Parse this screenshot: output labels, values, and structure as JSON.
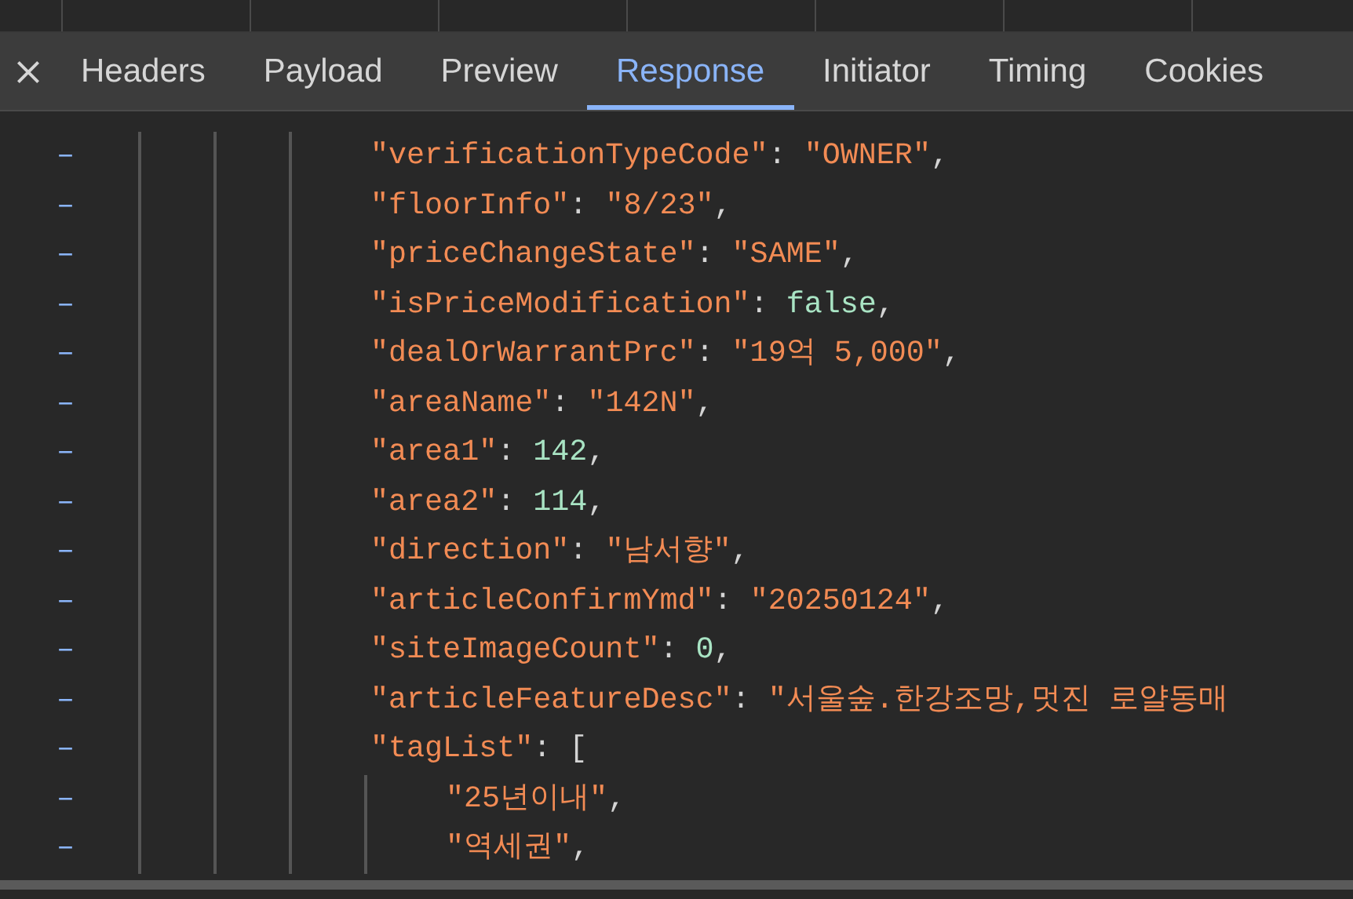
{
  "tabs": [
    {
      "label": "Headers",
      "selected": false
    },
    {
      "label": "Payload",
      "selected": false
    },
    {
      "label": "Preview",
      "selected": false
    },
    {
      "label": "Response",
      "selected": true
    },
    {
      "label": "Initiator",
      "selected": false
    },
    {
      "label": "Timing",
      "selected": false
    },
    {
      "label": "Cookies",
      "selected": false
    }
  ],
  "code_lines": [
    {
      "marker": "–",
      "parts": [
        {
          "kind": "key",
          "text": "\"verificationTypeCode\""
        },
        {
          "kind": "punct",
          "text": ": "
        },
        {
          "kind": "string",
          "text": "\"OWNER\""
        },
        {
          "kind": "punct",
          "text": ","
        }
      ]
    },
    {
      "marker": "–",
      "parts": [
        {
          "kind": "key",
          "text": "\"floorInfo\""
        },
        {
          "kind": "punct",
          "text": ": "
        },
        {
          "kind": "string",
          "text": "\"8/23\""
        },
        {
          "kind": "punct",
          "text": ","
        }
      ]
    },
    {
      "marker": "–",
      "parts": [
        {
          "kind": "key",
          "text": "\"priceChangeState\""
        },
        {
          "kind": "punct",
          "text": ": "
        },
        {
          "kind": "string",
          "text": "\"SAME\""
        },
        {
          "kind": "punct",
          "text": ","
        }
      ]
    },
    {
      "marker": "–",
      "parts": [
        {
          "kind": "key",
          "text": "\"isPriceModification\""
        },
        {
          "kind": "punct",
          "text": ": "
        },
        {
          "kind": "literal",
          "text": "false"
        },
        {
          "kind": "punct",
          "text": ","
        }
      ]
    },
    {
      "marker": "–",
      "parts": [
        {
          "kind": "key",
          "text": "\"dealOrWarrantPrc\""
        },
        {
          "kind": "punct",
          "text": ": "
        },
        {
          "kind": "string",
          "text": "\"19억 5,000\""
        },
        {
          "kind": "punct",
          "text": ","
        }
      ]
    },
    {
      "marker": "–",
      "parts": [
        {
          "kind": "key",
          "text": "\"areaName\""
        },
        {
          "kind": "punct",
          "text": ": "
        },
        {
          "kind": "string",
          "text": "\"142N\""
        },
        {
          "kind": "punct",
          "text": ","
        }
      ]
    },
    {
      "marker": "–",
      "parts": [
        {
          "kind": "key",
          "text": "\"area1\""
        },
        {
          "kind": "punct",
          "text": ": "
        },
        {
          "kind": "literal",
          "text": "142"
        },
        {
          "kind": "punct",
          "text": ","
        }
      ]
    },
    {
      "marker": "–",
      "parts": [
        {
          "kind": "key",
          "text": "\"area2\""
        },
        {
          "kind": "punct",
          "text": ": "
        },
        {
          "kind": "literal",
          "text": "114"
        },
        {
          "kind": "punct",
          "text": ","
        }
      ]
    },
    {
      "marker": "–",
      "parts": [
        {
          "kind": "key",
          "text": "\"direction\""
        },
        {
          "kind": "punct",
          "text": ": "
        },
        {
          "kind": "string",
          "text": "\"남서향\""
        },
        {
          "kind": "punct",
          "text": ","
        }
      ]
    },
    {
      "marker": "–",
      "parts": [
        {
          "kind": "key",
          "text": "\"articleConfirmYmd\""
        },
        {
          "kind": "punct",
          "text": ": "
        },
        {
          "kind": "string",
          "text": "\"20250124\""
        },
        {
          "kind": "punct",
          "text": ","
        }
      ]
    },
    {
      "marker": "–",
      "parts": [
        {
          "kind": "key",
          "text": "\"siteImageCount\""
        },
        {
          "kind": "punct",
          "text": ": "
        },
        {
          "kind": "literal",
          "text": "0"
        },
        {
          "kind": "punct",
          "text": ","
        }
      ]
    },
    {
      "marker": "–",
      "parts": [
        {
          "kind": "key",
          "text": "\"articleFeatureDesc\""
        },
        {
          "kind": "punct",
          "text": ": "
        },
        {
          "kind": "string",
          "text": "\"서울숲.한강조망,멋진 로얄동매"
        }
      ]
    },
    {
      "marker": "–",
      "parts": [
        {
          "kind": "key",
          "text": "\"tagList\""
        },
        {
          "kind": "punct",
          "text": ": ["
        }
      ],
      "children": [
        {
          "marker": "–",
          "parts": [
            {
              "kind": "string",
              "text": "\"25년이내\""
            },
            {
              "kind": "punct",
              "text": ","
            }
          ]
        },
        {
          "marker": "–",
          "parts": [
            {
              "kind": "string",
              "text": "\"역세권\""
            },
            {
              "kind": "punct",
              "text": ","
            }
          ]
        }
      ]
    }
  ]
}
